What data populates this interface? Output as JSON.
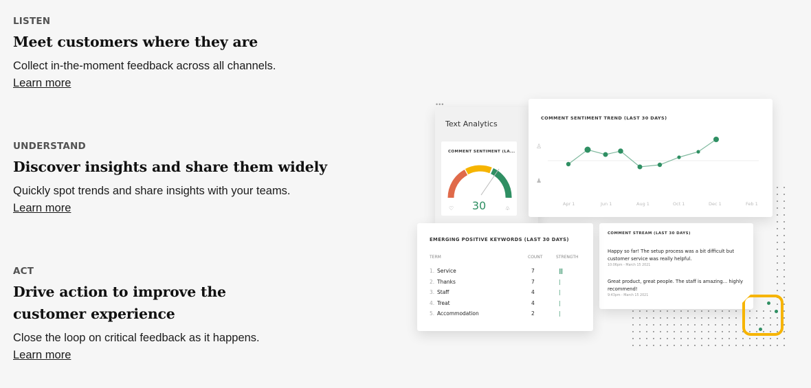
{
  "sections": [
    {
      "eyebrow": "LISTEN",
      "heading": "Meet customers where they are",
      "desc": "Collect in-the-moment feedback across all channels.",
      "link": "Learn more"
    },
    {
      "eyebrow": "UNDERSTAND",
      "heading": "Discover insights and share them widely",
      "desc": "Quickly spot trends and share insights with your teams.",
      "link": "Learn more"
    },
    {
      "eyebrow": "ACT",
      "heading": "Drive action to improve the customer experience",
      "desc": "Close the loop on critical feedback as it happens.",
      "link": "Learn more"
    }
  ],
  "text_analytics": {
    "title": "Text Analytics",
    "gauge_title": "COMMENT SENTIMENT (LA...",
    "gauge_value": "30",
    "gauge_color": "#2f8f63"
  },
  "trend": {
    "title": "COMMENT SENTIMENT TREND (LAST 30 DAYS)",
    "x_labels": [
      "Apr 1",
      "Jun 1",
      "Aug 1",
      "Oct 1",
      "Dec 1",
      "Feb 1"
    ]
  },
  "keywords": {
    "title": "EMERGING POSITIVE KEYWORDS (LAST 30 DAYS)",
    "col_term": "TERM",
    "col_count": "COUNT",
    "col_strength": "STRENGTH",
    "rows": [
      {
        "num": "1.",
        "term": "Service",
        "count": "7",
        "strength": 3
      },
      {
        "num": "2.",
        "term": "Thanks",
        "count": "7",
        "strength": 1
      },
      {
        "num": "3.",
        "term": "Staff",
        "count": "4",
        "strength": 1
      },
      {
        "num": "4.",
        "term": "Treat",
        "count": "4",
        "strength": 1
      },
      {
        "num": "5.",
        "term": "Accommodation",
        "count": "2",
        "strength": 1
      }
    ]
  },
  "stream": {
    "title": "COMMENT STREAM (LAST 30 DAYS)",
    "items": [
      {
        "text": "Happy so far! The setup process was a bit difficult but customer service was really helpful.",
        "time": "10:06pm - March 15 2021"
      },
      {
        "text": "Great product, great people. The staff is amazing... highly recommend!",
        "time": "9:43pm - March 15 2021"
      }
    ]
  },
  "colors": {
    "accent_green": "#2f8f63",
    "accent_yellow": "#f6b400",
    "accent_red": "#e06a4a"
  }
}
